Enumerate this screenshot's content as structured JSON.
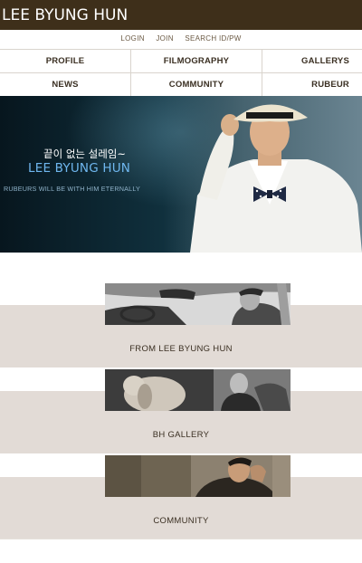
{
  "header": {
    "logo": "LEE BYUNG HUN",
    "background": "#3e2f1a"
  },
  "util_links": [
    "LOGIN",
    "JOIN",
    "SEARCH ID/PW"
  ],
  "nav": {
    "row1": [
      "PROFILE",
      "FILMOGRAPHY",
      "GALLERYS"
    ],
    "row2": [
      "NEWS",
      "COMMUNITY",
      "RUBEUR"
    ]
  },
  "banner": {
    "korean": "끝이 없는 설레임~",
    "title": "LEE BYUNG HUN",
    "subtitle": "RUBEURS WILL BE WITH HIM ETERNALLY",
    "title_color": "#6fb7ef"
  },
  "sections": [
    {
      "label": "FROM LEE BYUNG HUN"
    },
    {
      "label": "BH GALLERY"
    },
    {
      "label": "COMMUNITY"
    }
  ],
  "colors": {
    "band": "#e2dbd6",
    "nav_text": "#3a2f22"
  }
}
